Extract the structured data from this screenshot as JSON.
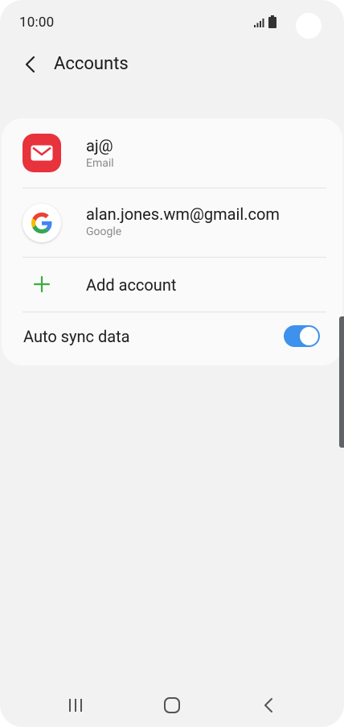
{
  "status_bar": {
    "time": "10:00",
    "icons": [
      "signal-icon",
      "battery-icon"
    ]
  },
  "app_bar": {
    "title": "Accounts",
    "back_icon": "chevron-left-icon"
  },
  "accounts": [
    {
      "name": "aj@",
      "type": "Email",
      "icon": "email-icon"
    },
    {
      "name": "alan.jones.wm@gmail.com",
      "type": "Google",
      "icon": "google-icon"
    }
  ],
  "add_account": {
    "label": "Add account",
    "icon": "plus-icon"
  },
  "auto_sync": {
    "label": "Auto sync data",
    "enabled": true
  },
  "nav_bar": {
    "buttons": [
      "recents-icon",
      "home-icon",
      "back-icon"
    ]
  },
  "colors": {
    "background": "#f2f2f2",
    "card": "#fafafa",
    "email_icon_bg": "#e8323c",
    "toggle_on": "#3e91ec",
    "plus_green": "#3cac3c"
  }
}
